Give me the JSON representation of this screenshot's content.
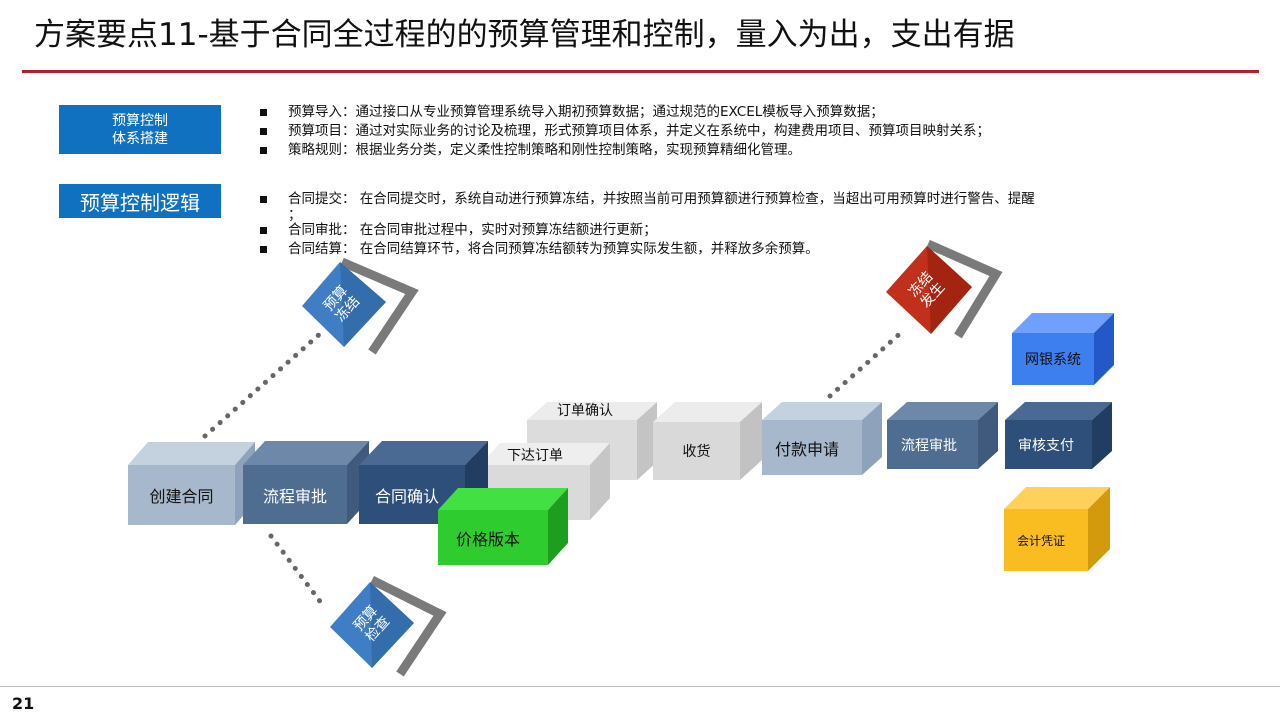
{
  "page": {
    "title": "方案要点11-基于合同全过程的的预算管理和控制，量入为出，支出有据",
    "page_number": "21"
  },
  "section1": {
    "label_line1": "预算控制",
    "label_line2": "体系搭建",
    "bullets": [
      "预算导入：通过接口从专业预算管理系统导入期初预算数据；通过规范的EXCEL模板导入预算数据；",
      "预算项目：通过对实际业务的讨论及梳理，形式预算项目体系，并定义在系统中，构建费用项目、预算项目映射关系；",
      "策略规则：根据业务分类，定义柔性控制策略和刚性控制策略，实现预算精细化管理。"
    ]
  },
  "section2": {
    "label": "预算控制逻辑",
    "bullets": [
      "合同提交： 在合同提交时，系统自动进行预算冻结，并按照当前可用预算额进行预算检查，当超出可用预算时进行警告、提醒",
      "合同审批： 在合同审批过程中，实时对预算冻结额进行更新；",
      "合同结算： 在合同结算环节，将合同预算冻结额转为预算实际发生额，并释放多余预算。"
    ],
    "bullet1_continuation": "；"
  },
  "diagram": {
    "cubes": {
      "create_contract": "创建合同",
      "flow_approval": "流程审批",
      "contract_confirm": "合同确认",
      "order_confirm": "订单确认",
      "place_order": "下达订单",
      "price_version": "价格版本",
      "receive_goods": "收货",
      "payment_request": "付款申请",
      "flow_approval_2": "流程审批",
      "audit_payment": "审核支付",
      "bank_system": "网银系统",
      "accounting_voucher": "会计凭证"
    },
    "tags": {
      "budget_freeze": "预算\n冻结",
      "budget_check": "预算\n检查",
      "freeze_occur": "冻结\n发生"
    }
  },
  "colors": {
    "title_rule": "#b11f2c",
    "label_blue": "#0f71bf",
    "light_steel": "#a7b8cc",
    "mid_steel": "#4f6d90",
    "dark_steel": "#2e4f7a",
    "grey_cube": "#d9d9d9",
    "green_cube": "#2fcc2f",
    "blue_cube": "#3d7fef",
    "gold_cube": "#f9bd22",
    "red_tag": "#c0301a"
  }
}
